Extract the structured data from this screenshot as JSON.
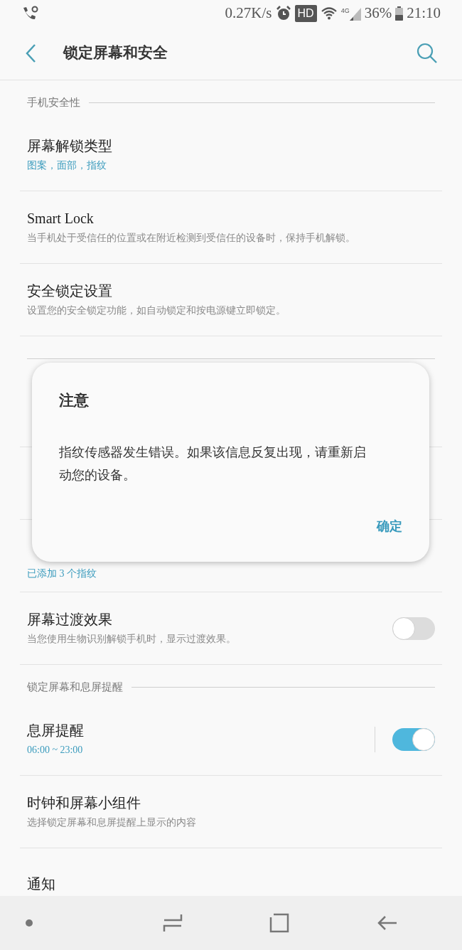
{
  "status_bar": {
    "speed": "0.27K/s",
    "hd": "HD",
    "network": "4G",
    "battery": "36%",
    "time": "21:10"
  },
  "header": {
    "title": "锁定屏幕和安全"
  },
  "list": [
    {
      "kind": "header",
      "label": "手机安全性"
    },
    {
      "kind": "item",
      "title": "屏幕解锁类型",
      "subtitle": "图案，面部，指纹",
      "accent": true
    },
    {
      "kind": "item",
      "title": "Smart Lock",
      "subtitle": "当手机处于受信任的位置或在附近检测到受信任的设备时，保持手机解锁。",
      "accent": false
    },
    {
      "kind": "item",
      "title": "安全锁定设置",
      "subtitle": "设置您的安全锁定功能，如自动锁定和按电源键立即锁定。",
      "accent": false
    },
    {
      "kind": "header"
    },
    {
      "kind": "item"
    },
    {
      "kind": "item"
    },
    {
      "kind": "item",
      "subtitle": "已添加 3 个指纹",
      "accent": true
    },
    {
      "kind": "toggle",
      "title": "屏幕过渡效果",
      "subtitle": "当您使用生物识别解锁手机时，显示过渡效果。",
      "accent": false,
      "on": false,
      "divider": false
    },
    {
      "kind": "header",
      "label": "锁定屏幕和息屏提醒"
    },
    {
      "kind": "toggle",
      "title": "息屏提醒",
      "subtitle": "06:00 ~ 23:00",
      "accent": true,
      "on": true,
      "divider": true
    },
    {
      "kind": "item",
      "title": "时钟和屏幕小组件",
      "subtitle": "选择锁定屏幕和息屏提醒上显示的内容",
      "accent": false
    },
    {
      "kind": "item",
      "title": "通知"
    }
  ],
  "dialog": {
    "title": "注意",
    "message": "指纹传感器发生错误。如果该信息反复出现，请重新启动您的设备。",
    "button": "确定"
  }
}
